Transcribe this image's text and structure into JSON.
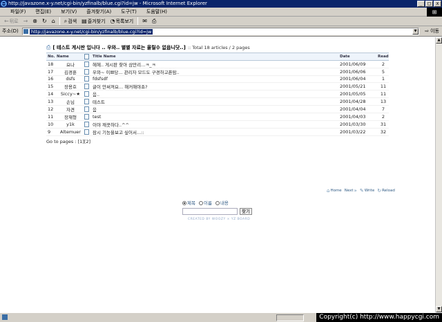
{
  "window": {
    "title": "http://javazone.x-y.net/cgi-bin/yzfinalb/blue.cgi?id=jw - Microsoft Internet Explorer",
    "min": "_",
    "max": "□",
    "close": "x"
  },
  "menu": {
    "items": [
      "파일(F)",
      "편집(E)",
      "보기(V)",
      "즐겨찾기(A)",
      "도구(T)",
      "도움말(H)"
    ]
  },
  "toolbar": {
    "back": "뒤로",
    "forward": "→",
    "stop": "⊗",
    "refresh": "↻",
    "home": "⌂",
    "search_label": "검색",
    "favorites_label": "즐겨찾기",
    "history_label": "목록보기",
    "mail": "✉",
    "print": "⎙"
  },
  "address": {
    "label": "주소(D)",
    "url": "http://javazone.x-y.net/cgi-bin/yzfinalb/blue.cgi?id=jw",
    "go_label": "이동"
  },
  "board": {
    "title": "[ 테스트 게시판 입니다 .. 우와.. 별별 자료는 올릴수 없읍니닷..]",
    "total": ":: Total 18 articles / 2 pages",
    "columns": {
      "no": "No.",
      "name": "Name",
      "title": "Title Name",
      "date": "Date",
      "read": "Read"
    },
    "rows": [
      {
        "no": "18",
        "name": "요나",
        "title": "헤헤.. 게시판 찾아 삼만리...ㅋ_ㅋ",
        "date": "2001/06/09",
        "read": "2"
      },
      {
        "no": "17",
        "name": "김경훈",
        "title": "우와~ 이쁘당... 관리자 모드도 구경하고픈맘..",
        "date": "2001/06/06",
        "read": "5"
      },
      {
        "no": "16",
        "name": "dsfs",
        "title": "fdsfsdf",
        "date": "2001/06/04",
        "read": "1"
      },
      {
        "no": "15",
        "name": "장용호",
        "title": "글이 안써져요... 해커해야죠?",
        "date": "2001/05/21",
        "read": "11"
      },
      {
        "no": "14",
        "name": "Siccy~★",
        "title": "음..",
        "date": "2001/05/05",
        "read": "11"
      },
      {
        "no": "13",
        "name": "손님",
        "title": "테스트",
        "date": "2001/04/28",
        "read": "13"
      },
      {
        "no": "12",
        "name": "자견",
        "title": "음",
        "date": "2001/04/04",
        "read": "7"
      },
      {
        "no": "11",
        "name": "장재형",
        "title": "test",
        "date": "2001/04/03",
        "read": "2"
      },
      {
        "no": "10",
        "name": "y1k",
        "title": "이야 깨끗하다..^^",
        "date": "2001/03/30",
        "read": "31"
      },
      {
        "no": "9",
        "name": "Altemuer",
        "title": "잠시 기능을보고 싶어서...::",
        "date": "2001/03/22",
        "read": "32"
      }
    ],
    "goto_label": "Go to pages :",
    "pages": "[1][2]"
  },
  "navicons": {
    "home": "Home",
    "next": "Next",
    "write": "Write",
    "reload": "Reload"
  },
  "search": {
    "opt_title": "제목",
    "opt_name": "이름",
    "opt_content": "내용",
    "input_value": "",
    "button": "찾기"
  },
  "credit": "CREATED BY WOOZY × YZ BOARD",
  "status": {
    "copyright": "Copyright(c) http://www.happycgi.com"
  },
  "colors": {
    "titlebar": "#0a246a",
    "chrome": "#d4d0c8",
    "table_header": "#eef4fb",
    "link_blue": "#2f5a84"
  }
}
